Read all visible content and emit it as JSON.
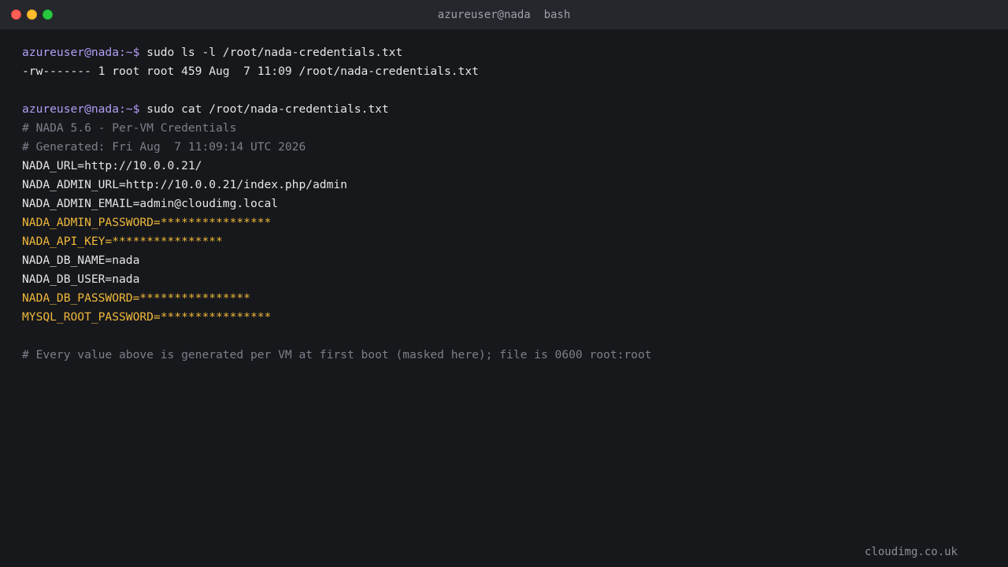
{
  "window": {
    "title": "azureuser@nada  bash"
  },
  "terminal": {
    "lines": [
      {
        "prompt": "azureuser@nada:~$",
        "cmd": " sudo ls -l /root/nada-credentials.txt"
      },
      {
        "out": "-rw------- 1 root root 459 Aug  7 11:09 /root/nada-credentials.txt"
      },
      {
        "blank": ""
      },
      {
        "prompt": "azureuser@nada:~$",
        "cmd": " sudo cat /root/nada-credentials.txt"
      },
      {
        "comment": "# NADA 5.6 - Per-VM Credentials"
      },
      {
        "comment": "# Generated: Fri Aug  7 11:09:14 UTC 2026"
      },
      {
        "out": "NADA_URL=http://10.0.0.21/"
      },
      {
        "out": "NADA_ADMIN_URL=http://10.0.0.21/index.php/admin"
      },
      {
        "out": "NADA_ADMIN_EMAIL=admin@cloudimg.local"
      },
      {
        "secret": "NADA_ADMIN_PASSWORD=****************"
      },
      {
        "secret": "NADA_API_KEY=****************"
      },
      {
        "out": "NADA_DB_NAME=nada"
      },
      {
        "out": "NADA_DB_USER=nada"
      },
      {
        "secret": "NADA_DB_PASSWORD=****************"
      },
      {
        "secret": "MYSQL_ROOT_PASSWORD=****************"
      },
      {
        "blank": ""
      },
      {
        "comment": "# Every value above is generated per VM at first boot (masked here); file is 0600 root:root"
      }
    ]
  },
  "footer": {
    "brand": "cloudimg.co.uk"
  },
  "colors": {
    "prompt": "#b39df3",
    "secret": "#f0b93a",
    "comment": "#7b7f89",
    "background": "#17181c"
  }
}
